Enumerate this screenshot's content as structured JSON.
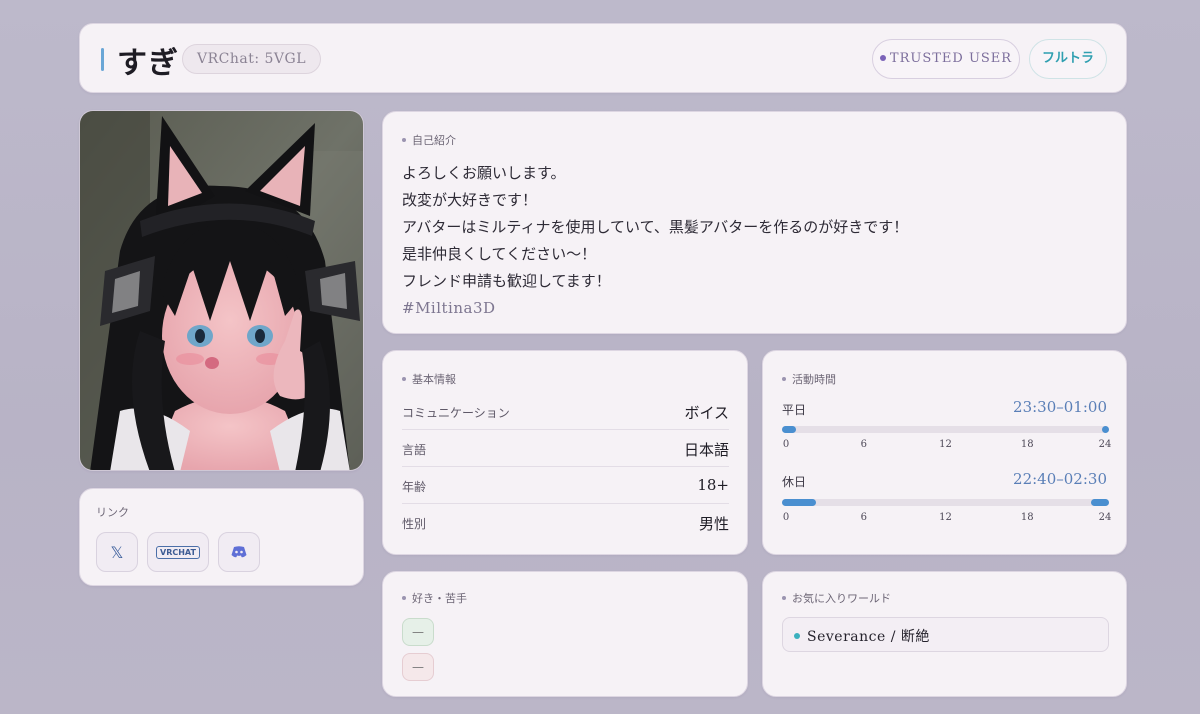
{
  "header": {
    "name": "すぎ",
    "vrchat_id": "VRChat: 5VGL",
    "trusted_badge": "TRUSTED USER",
    "fulltra_badge": "フルトラ"
  },
  "links": {
    "label": "リンク",
    "items": [
      {
        "name": "x",
        "glyph": "𝕏"
      },
      {
        "name": "vrchat",
        "glyph": "VRCHAT"
      },
      {
        "name": "discord",
        "glyph": ""
      }
    ]
  },
  "intro": {
    "label": "自己紹介",
    "lines": [
      "よろしくお願いします。",
      "改変が大好きです！",
      "アバターはミルティナを使用していて、黒髪アバターを作るのが好きです！",
      "是非仲良くしてください〜！",
      "フレンド申請も歓迎してます！"
    ],
    "tag": "#Miltina3D"
  },
  "basic": {
    "label": "基本情報",
    "rows": [
      {
        "key": "コミュニケーション",
        "value": "ボイス"
      },
      {
        "key": "言語",
        "value": "日本語"
      },
      {
        "key": "年齢",
        "value": "18+"
      },
      {
        "key": "性別",
        "value": "男性"
      }
    ]
  },
  "activity": {
    "label": "活動時間",
    "accent": "#4a8fd0",
    "ticks": [
      "0",
      "6",
      "12",
      "18",
      "24"
    ],
    "weekday": {
      "label": "平日",
      "time": "23:30–01:00",
      "start_hour": 23.5,
      "end_hour": 1.0
    },
    "holiday": {
      "label": "休日",
      "time": "22:40–02:30",
      "start_hour": 22.67,
      "end_hour": 2.5
    }
  },
  "likes": {
    "label": "好き・苦手",
    "like_value": "—",
    "dislike_value": "—"
  },
  "world": {
    "label": "お気に入りワールド",
    "items": [
      "Severance / 断絶"
    ]
  }
}
